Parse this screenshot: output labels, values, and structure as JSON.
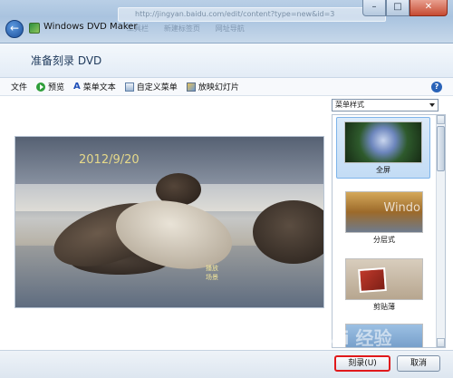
{
  "window": {
    "title": "Windows DVD Maker",
    "browser_url": "http://jingyan.baidu.com/edit/content?type=new&id=3",
    "browser_tabs": [
      "工具栏",
      "新建标签页",
      "网址导航"
    ],
    "controls": {
      "minimize": "–",
      "maximize": "□",
      "close": "✕"
    }
  },
  "header": {
    "page_title": "准备刻录 DVD"
  },
  "toolbar": {
    "file": "文件",
    "preview": "预览",
    "menu_text": "菜单文本",
    "custom_menu": "自定义菜单",
    "slideshow": "放映幻灯片",
    "help": "?"
  },
  "preview": {
    "date": "2012/9/20",
    "menu_play": "播放",
    "menu_scenes": "场景"
  },
  "styles": {
    "dropdown_selected": "菜单样式",
    "items": [
      {
        "label": "全屏",
        "thumb_text": ""
      },
      {
        "label": "分层式",
        "thumb_text": "Windo"
      },
      {
        "label": "剪贴薄",
        "thumb_text": ""
      }
    ]
  },
  "footer": {
    "burn_label": "刻录(U)",
    "cancel_label": "取消",
    "watermark": "Bai 经验"
  },
  "colors": {
    "accent": "#2a63b8",
    "highlight_border": "#e0191b",
    "selected_bg": "#c3dcf5"
  }
}
